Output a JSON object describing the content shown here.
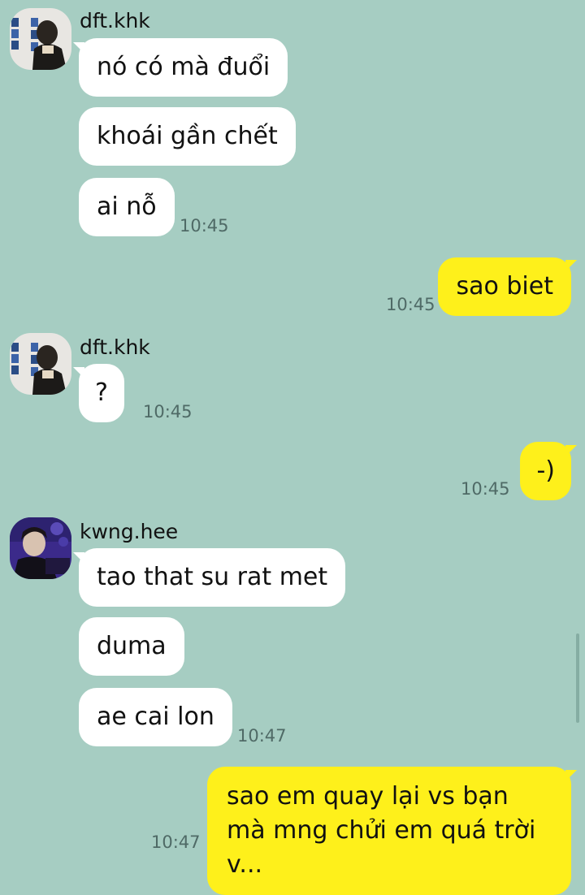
{
  "messages": [
    {
      "sender": "dft.khk",
      "lines": [
        "nó có mà đuổi",
        "khoái gần chết",
        "ai nỗ"
      ],
      "time": "10:45"
    },
    {
      "sender": "me",
      "lines": [
        "sao biet"
      ],
      "time": "10:45"
    },
    {
      "sender": "dft.khk",
      "lines": [
        "?"
      ],
      "time": "10:45"
    },
    {
      "sender": "me",
      "lines": [
        "-)"
      ],
      "time": "10:45"
    },
    {
      "sender": "kwng.hee",
      "lines": [
        "tao that su rat met",
        "duma",
        "ae cai lon"
      ],
      "time": "10:47"
    },
    {
      "sender": "me",
      "lines": [
        "sao em quay lại vs bạn mà mng chửi em quá trời v..."
      ],
      "time": "10:47"
    }
  ],
  "colors": {
    "background": "#a6cdc2",
    "incoming_bubble": "#ffffff",
    "outgoing_bubble": "#fef01b"
  }
}
